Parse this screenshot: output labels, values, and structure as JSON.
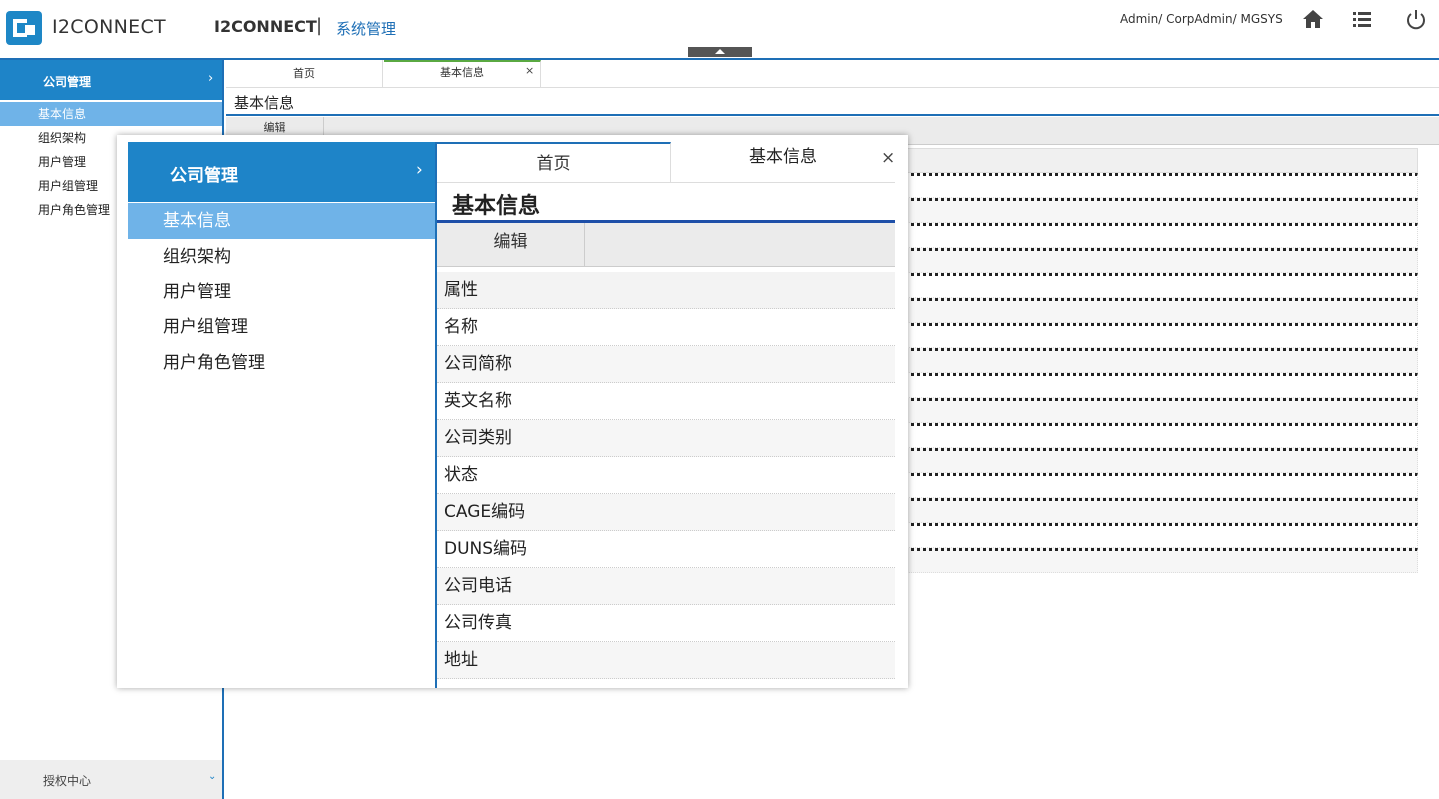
{
  "header": {
    "logo_text": "I2CONNECT",
    "app_title": "I2CONNECT",
    "separator": "|",
    "module_title": "系统管理",
    "user_info": "Admin/ CorpAdmin/ MGSYS"
  },
  "sidebar": {
    "section_title": "公司管理",
    "items": [
      {
        "label": "基本信息",
        "active": true
      },
      {
        "label": "组织架构",
        "active": false
      },
      {
        "label": "用户管理",
        "active": false
      },
      {
        "label": "用户组管理",
        "active": false
      },
      {
        "label": "用户角色管理",
        "active": false
      }
    ],
    "footer_title": "授权中心"
  },
  "tabs": [
    {
      "label": "首页"
    },
    {
      "label": "基本信息",
      "closable": true,
      "close_glyph": "×"
    }
  ],
  "page": {
    "title": "基本信息",
    "toolbar_edit": "编辑"
  },
  "properties": {
    "header": "属性",
    "rows": [
      "名称",
      "公司简称",
      "英文名称",
      "公司类别",
      "状态",
      "CAGE编码",
      "DUNS编码",
      "公司电话",
      "公司传真",
      "地址"
    ]
  },
  "icons": {
    "home": "home-icon",
    "list": "list-icon",
    "power": "power-icon",
    "chevron_right": "›",
    "chevron_down": "⌄"
  },
  "colors": {
    "primary": "#1e84c8",
    "active_item": "#6fb3e8",
    "accent_line": "#1e6fb6",
    "tab_active_top": "#5aa942"
  }
}
